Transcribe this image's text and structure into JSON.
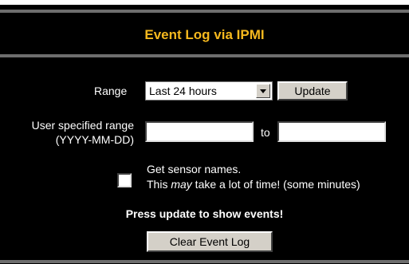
{
  "page": {
    "title": "Event Log via IPMI"
  },
  "range": {
    "label": "Range",
    "selected": "Last 24 hours",
    "update_label": "Update"
  },
  "user_range": {
    "label_line1": "User specified range",
    "label_line2": "(YYYY-MM-DD)",
    "from_value": "",
    "to_label": "to",
    "to_value": ""
  },
  "sensor": {
    "checked": false,
    "line1": "Get sensor names.",
    "line2_before": "This ",
    "line2_em": "may",
    "line2_after": " take a lot of time! (some minutes)"
  },
  "message": "Press update to show events!",
  "clear_label": "Clear Event Log",
  "colors": {
    "background": "#000000",
    "title": "#f5b81e",
    "separator": "#6e6e6e",
    "text": "#ffffff",
    "button_face": "#d4d0c8"
  }
}
